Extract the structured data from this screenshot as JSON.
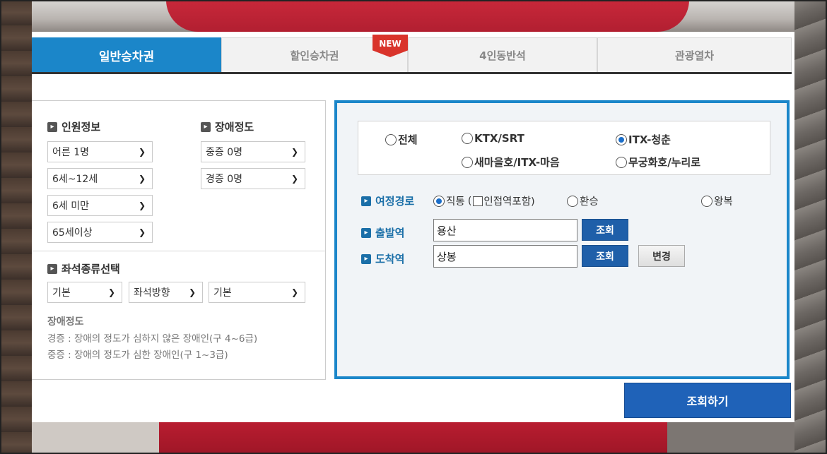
{
  "tabs": [
    {
      "label": "일반승차권",
      "active": true
    },
    {
      "label": "할인승차권",
      "badge": "NEW"
    },
    {
      "label": "4인동반석"
    },
    {
      "label": "관광열차"
    }
  ],
  "passenger": {
    "title": "인원정보",
    "adult": "어른 1명",
    "child": "6세~12세",
    "infant": "6세 미만",
    "senior": "65세이상"
  },
  "disability": {
    "title": "장애정도",
    "severe": "중증 0명",
    "mild": "경증 0명"
  },
  "seat": {
    "title": "좌석종류선택",
    "type": "기본",
    "direction": "좌석방향",
    "option": "기본"
  },
  "notes": {
    "title": "장애정도",
    "mild": "경증 : 장애의 정도가 심하지 않은 장애인(구 4~6급)",
    "severe": "중증 : 장애의 정도가 심한 장애인(구 1~3급)"
  },
  "train_types": {
    "all": "전체",
    "ktx": "KTX/SRT",
    "itx": "ITX-청춘",
    "saemaeul": "새마을호/ITX-마음",
    "mugunghwa": "무궁화호/누리로",
    "selected": "ITX-청춘"
  },
  "route": {
    "label": "여정경로",
    "direct": "직통",
    "paren_open": "(",
    "include_adjacent": "인접역포함)",
    "transfer": "환승",
    "round_trip": "왕복"
  },
  "departure": {
    "label": "출발역",
    "value": "용산",
    "button": "조회"
  },
  "arrival": {
    "label": "도착역",
    "value": "상봉",
    "button": "조회",
    "swap": "변경"
  },
  "submit_label": "조회하기",
  "colors": {
    "accent": "#1b86c9",
    "button": "#1f62b8",
    "badge": "#d9342b"
  }
}
